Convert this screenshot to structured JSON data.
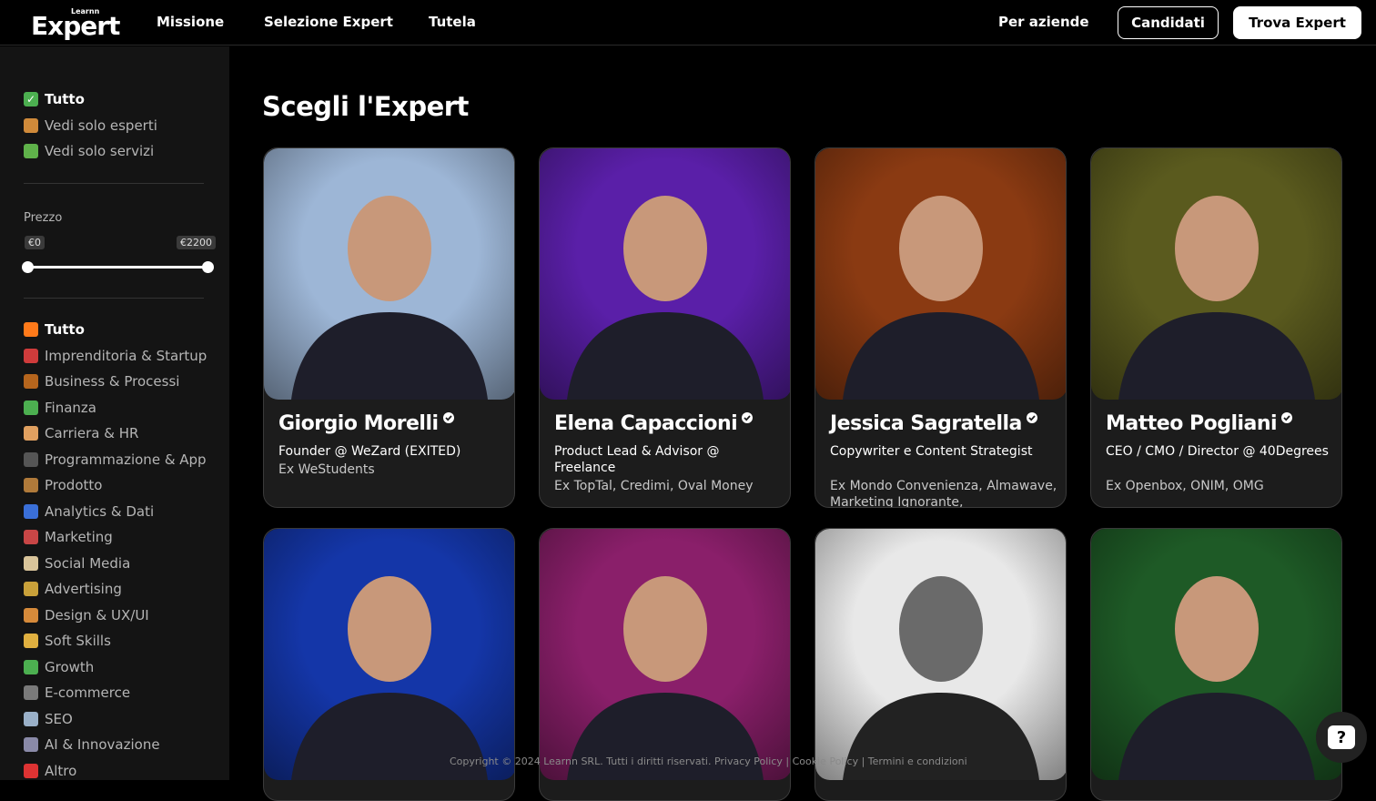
{
  "header": {
    "logo_small": "Learnn",
    "logo_big": "Expert",
    "nav": [
      "Missione",
      "Selezione Expert",
      "Tutela"
    ],
    "for_companies": "Per aziende",
    "apply_button": "Candidati",
    "find_button": "Trova Expert"
  },
  "sidebar": {
    "type_filters": [
      {
        "icon": "check-icon",
        "label": "Tutto",
        "active": true
      },
      {
        "icon": "person-icon",
        "label": "Vedi solo esperti",
        "active": false
      },
      {
        "icon": "puzzle-icon",
        "label": "Vedi solo servizi",
        "active": false
      }
    ],
    "price": {
      "label": "Prezzo",
      "min": "€0",
      "max": "€2200"
    },
    "categories": [
      {
        "icon": "fire-icon",
        "label": "Tutto",
        "active": true
      },
      {
        "icon": "rocket-icon",
        "label": "Imprenditoria & Startup"
      },
      {
        "icon": "building-icon",
        "label": "Business & Processi"
      },
      {
        "icon": "chart-check-icon",
        "label": "Finanza"
      },
      {
        "icon": "person-icon",
        "label": "Carriera & HR"
      },
      {
        "icon": "laptop-icon",
        "label": "Programmazione & App"
      },
      {
        "icon": "box-icon",
        "label": "Prodotto"
      },
      {
        "icon": "bar-chart-icon",
        "label": "Analytics & Dati"
      },
      {
        "icon": "trend-icon",
        "label": "Marketing"
      },
      {
        "icon": "popcorn-icon",
        "label": "Social Media"
      },
      {
        "icon": "money-bag-icon",
        "label": "Advertising"
      },
      {
        "icon": "palette-icon",
        "label": "Design & UX/UI"
      },
      {
        "icon": "handshake-icon",
        "label": "Soft Skills"
      },
      {
        "icon": "sprout-icon",
        "label": "Growth"
      },
      {
        "icon": "cart-icon",
        "label": "E-commerce"
      },
      {
        "icon": "magnifier-icon",
        "label": "SEO"
      },
      {
        "icon": "robot-icon",
        "label": "AI & Innovazione"
      },
      {
        "icon": "question-icon",
        "label": "Altro"
      }
    ]
  },
  "main": {
    "title": "Scegli l'Expert",
    "experts": [
      {
        "name": "Giorgio Morelli",
        "role": "Founder @ WeZard (EXITED)",
        "ex": "Ex WeStudents",
        "bg": "#9db6d6"
      },
      {
        "name": "Elena Capaccioni",
        "role": "Product Lead & Advisor @ Freelance",
        "ex": "Ex TopTal, Credimi, Oval Money",
        "bg": "#5a1fa8"
      },
      {
        "name": "Jessica Sagratella",
        "role": "Copywriter e Content Strategist",
        "ex": "Ex Mondo Convenienza, Almawave, Marketing Ignorante,",
        "bg": "#8a3a12"
      },
      {
        "name": "Matteo Pogliani",
        "role": "CEO / CMO / Director @ 40Degrees",
        "ex": "Ex Openbox, ONIM, OMG",
        "bg": "#5a5a1e"
      },
      {
        "name": "",
        "role": "",
        "ex": "",
        "bg": "#1436a8"
      },
      {
        "name": "",
        "role": "",
        "ex": "",
        "bg": "#8a1f6a"
      },
      {
        "name": "",
        "role": "",
        "ex": "",
        "bg": "#e8e8e8"
      },
      {
        "name": "",
        "role": "",
        "ex": "",
        "bg": "#1e5a26"
      }
    ]
  },
  "footer": {
    "text": "Copyright © 2024 Learnn SRL. Tutti i diritti riservati. Privacy Policy | Cookie Policy | Termini e condizioni"
  },
  "help": {
    "label": "?"
  }
}
